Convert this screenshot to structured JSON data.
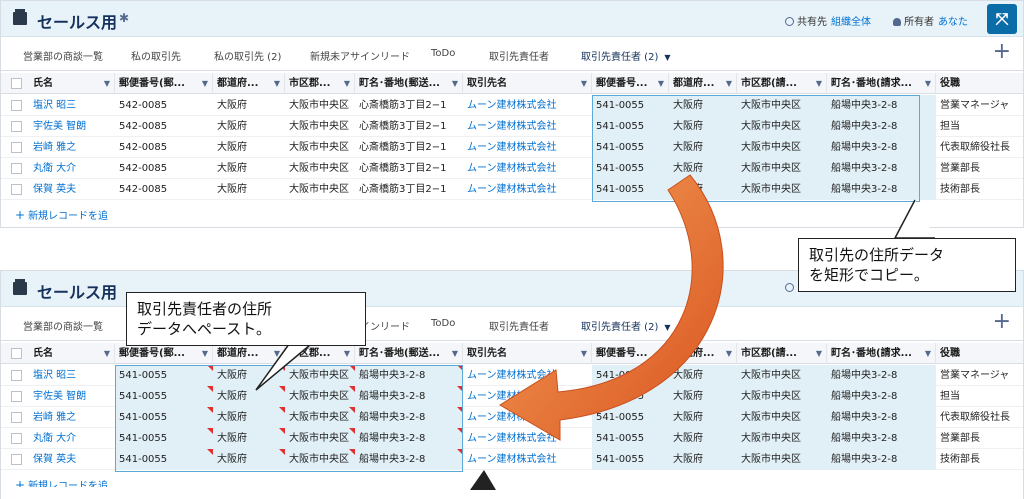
{
  "header": {
    "title": "セールス用",
    "share_label": "共有先",
    "share_value": "組織全体",
    "owner_label": "所有者",
    "owner_value": "あなた",
    "expand_glyph": "⤧"
  },
  "tabs": [
    {
      "label": "営業部の商談一覧"
    },
    {
      "label": "私の取引先"
    },
    {
      "label": "私の取引先 (2)"
    },
    {
      "label": "新規未アサインリード"
    },
    {
      "label": "ToDo"
    },
    {
      "label": "取引先責任者"
    },
    {
      "label": "取引先責任者 (2)",
      "active": true
    }
  ],
  "add_glyph": "+",
  "columns": [
    "氏名",
    "郵便番号(郵...",
    "都道府...",
    "市区郡...",
    "町名･番地(郵送...",
    "取引先名",
    "郵便番号...",
    "都道府...",
    "市区郡(請...",
    "町名･番地(請求...",
    "役職"
  ],
  "top_rows": [
    [
      "塩沢 昭三",
      "542-0085",
      "大阪府",
      "大阪市中央区",
      "心斎橋筋3丁目2−1",
      "ムーン建材株式会社",
      "541-0055",
      "大阪府",
      "大阪市中央区",
      "船場中央3-2-8",
      "営業マネージャ"
    ],
    [
      "宇佐美 智朗",
      "542-0085",
      "大阪府",
      "大阪市中央区",
      "心斎橋筋3丁目2−1",
      "ムーン建材株式会社",
      "541-0055",
      "大阪府",
      "大阪市中央区",
      "船場中央3-2-8",
      "担当"
    ],
    [
      "岩崎 雅之",
      "542-0085",
      "大阪府",
      "大阪市中央区",
      "心斎橋筋3丁目2−1",
      "ムーン建材株式会社",
      "541-0055",
      "大阪府",
      "大阪市中央区",
      "船場中央3-2-8",
      "代表取締役社長"
    ],
    [
      "丸衛 大介",
      "542-0085",
      "大阪府",
      "大阪市中央区",
      "心斎橋筋3丁目2−1",
      "ムーン建材株式会社",
      "541-0055",
      "大阪府",
      "大阪市中央区",
      "船場中央3-2-8",
      "営業部長"
    ],
    [
      "保賀 英夫",
      "542-0085",
      "大阪府",
      "大阪市中央区",
      "心斎橋筋3丁目2−1",
      "ムーン建材株式会社",
      "541-0055",
      "大阪府",
      "大阪市中央区",
      "船場中央3-2-8",
      "技術部長"
    ]
  ],
  "bottom_rows": [
    [
      "塩沢 昭三",
      "541-0055",
      "大阪府",
      "大阪市中央区",
      "船場中央3-2-8",
      "ムーン建材株式会社",
      "541-0055",
      "大阪府",
      "大阪市中央区",
      "船場中央3-2-8",
      "営業マネージャ"
    ],
    [
      "宇佐美 智朗",
      "541-0055",
      "大阪府",
      "大阪市中央区",
      "船場中央3-2-8",
      "ムーン建材株式会社",
      "541-0055",
      "大阪府",
      "大阪市中央区",
      "船場中央3-2-8",
      "担当"
    ],
    [
      "岩崎 雅之",
      "541-0055",
      "大阪府",
      "大阪市中央区",
      "船場中央3-2-8",
      "ムーン建材株式会社",
      "541-0055",
      "大阪府",
      "大阪市中央区",
      "船場中央3-2-8",
      "代表取締役社長"
    ],
    [
      "丸衛 大介",
      "541-0055",
      "大阪府",
      "大阪市中央区",
      "船場中央3-2-8",
      "ムーン建材株式会社",
      "541-0055",
      "大阪府",
      "大阪市中央区",
      "船場中央3-2-8",
      "営業部長"
    ],
    [
      "保賀 英夫",
      "541-0055",
      "大阪府",
      "大阪市中央区",
      "船場中央3-2-8",
      "ムーン建材株式会社",
      "541-0055",
      "大阪府",
      "大阪市中央区",
      "船場中央3-2-8",
      "技術部長"
    ]
  ],
  "new_record_label": "新規レコードを追",
  "callouts": {
    "copy_line1": "取引先の住所データ",
    "copy_line2": "を矩形でコピー。",
    "paste_line1": "取引先責任者の住所",
    "paste_line2": "データへペースト。"
  },
  "colors": {
    "accent": "#0070d2",
    "selection": "#e1f0f7",
    "arrow": "#e8692a",
    "header_bg": "#e8f3f9"
  }
}
